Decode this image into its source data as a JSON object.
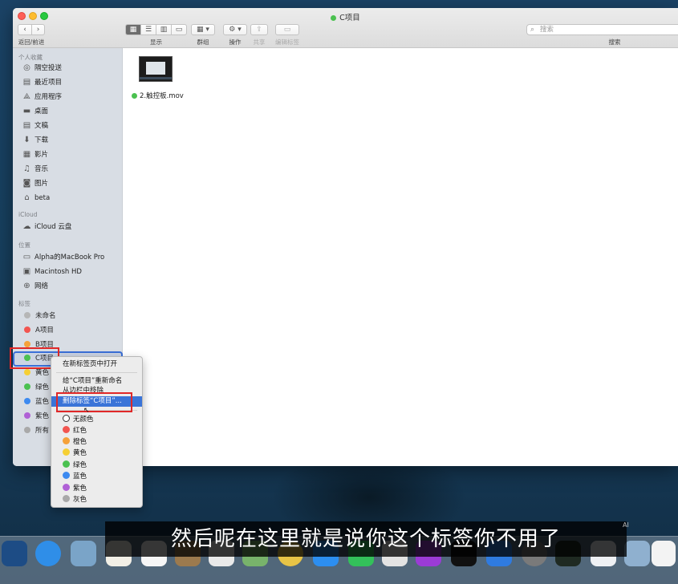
{
  "window": {
    "title": "C项目",
    "title_tag_color": "#4bc150"
  },
  "toolbar": {
    "back_forward_label": "返回/前进",
    "view_label": "显示",
    "group_label": "群组",
    "action_label": "操作",
    "share_label": "共享",
    "edit_tags_label": "编辑标签",
    "search_label": "搜索",
    "search_placeholder": "搜索"
  },
  "sidebar": {
    "favorites_header": "个人收藏",
    "favorites": [
      {
        "label": "隔空投送",
        "icon": "airdrop-icon"
      },
      {
        "label": "最近项目",
        "icon": "recents-icon"
      },
      {
        "label": "应用程序",
        "icon": "applications-icon"
      },
      {
        "label": "桌面",
        "icon": "desktop-icon"
      },
      {
        "label": "文稿",
        "icon": "documents-icon"
      },
      {
        "label": "下载",
        "icon": "downloads-icon"
      },
      {
        "label": "影片",
        "icon": "movies-icon"
      },
      {
        "label": "音乐",
        "icon": "music-icon"
      },
      {
        "label": "图片",
        "icon": "pictures-icon"
      },
      {
        "label": "beta",
        "icon": "home-icon"
      }
    ],
    "icloud_header": "iCloud",
    "icloud": [
      {
        "label": "iCloud 云盘",
        "icon": "cloud-icon"
      }
    ],
    "locations_header": "位置",
    "locations": [
      {
        "label": "Alpha的MacBook Pro",
        "icon": "laptop-icon"
      },
      {
        "label": "Macintosh HD",
        "icon": "disk-icon"
      },
      {
        "label": "网络",
        "icon": "network-icon"
      }
    ],
    "tags_header": "标签",
    "tags": [
      {
        "label": "未命名",
        "color": "#b6b6b6"
      },
      {
        "label": "A项目",
        "color": "#f25550"
      },
      {
        "label": "B项目",
        "color": "#f5a13a"
      },
      {
        "label": "C项目",
        "color": "#4bc150"
      },
      {
        "label": "黄色",
        "color": "#f6cf34"
      },
      {
        "label": "绿色",
        "color": "#4bc150"
      },
      {
        "label": "蓝色",
        "color": "#3d8af0"
      },
      {
        "label": "紫色",
        "color": "#b061d6"
      },
      {
        "label": "所有",
        "color": "#a9a9a9"
      }
    ]
  },
  "content": {
    "file_name": "2.触控板.mov",
    "file_tag_color": "#4bc150"
  },
  "context_menu": {
    "open_in_new_tab": "在新标签页中打开",
    "rename": "给“C项目”重新命名",
    "remove_from_sidebar": "从边栏中移除",
    "delete_tag": "删除标签“C项目”...",
    "colors": [
      {
        "label": "无颜色",
        "color": "#ffffff"
      },
      {
        "label": "红色",
        "color": "#f25550"
      },
      {
        "label": "橙色",
        "color": "#f5a13a"
      },
      {
        "label": "黄色",
        "color": "#f6cf34"
      },
      {
        "label": "绿色",
        "color": "#4bc150"
      },
      {
        "label": "蓝色",
        "color": "#3d8af0"
      },
      {
        "label": "紫色",
        "color": "#b061d6"
      },
      {
        "label": "灰色",
        "color": "#a9a9a9"
      }
    ]
  },
  "subtitle": {
    "text": "然后呢在这里就是说你这个标签你不用了",
    "badge": "AI"
  }
}
